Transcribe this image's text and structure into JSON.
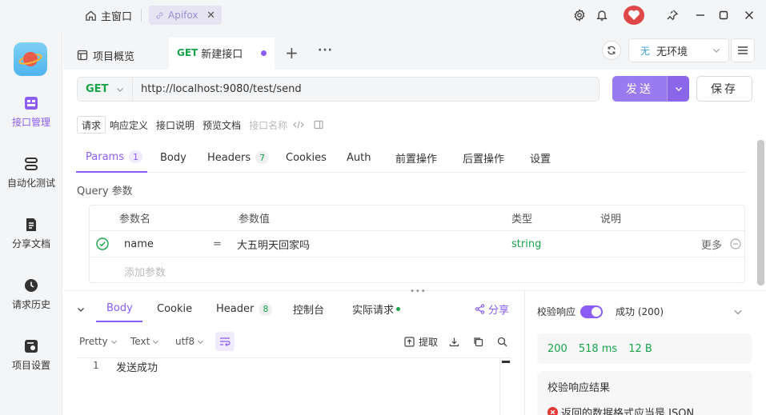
{
  "titlebar": {
    "home_label": "主窗口",
    "app_tab_label": "Apifox"
  },
  "sidebar": {
    "items": [
      {
        "label": "接口管理"
      },
      {
        "label": "自动化测试"
      },
      {
        "label": "分享文档"
      },
      {
        "label": "请求历史"
      },
      {
        "label": "项目设置"
      }
    ]
  },
  "tabs": {
    "overview_label": "项目概览",
    "active_method": "GET",
    "active_label": "新建接口",
    "add": "+",
    "more": "···"
  },
  "env": {
    "badge": "无",
    "label": "无环境"
  },
  "request": {
    "method": "GET",
    "url": "http://localhost:9080/test/send",
    "send_label": "发送",
    "save_label": "保存"
  },
  "subtabs": [
    "请求",
    "响应定义",
    "接口说明",
    "预览文档"
  ],
  "subtab_placeholder": "接口名称",
  "param_tabs": [
    {
      "label": "Params",
      "count": "1"
    },
    {
      "label": "Body"
    },
    {
      "label": "Headers",
      "count": "7"
    },
    {
      "label": "Cookies"
    },
    {
      "label": "Auth"
    },
    {
      "label": "前置操作"
    },
    {
      "label": "后置操作"
    },
    {
      "label": "设置"
    }
  ],
  "query": {
    "title": "Query 参数",
    "headers": {
      "name": "参数名",
      "value": "参数值",
      "type": "类型",
      "desc": "说明"
    },
    "rows": [
      {
        "name": "name",
        "op": "=",
        "value": "大五明天回家吗",
        "type": "string",
        "more": "更多"
      }
    ],
    "add_placeholder": "添加参数"
  },
  "response": {
    "tabs": [
      {
        "label": "Body"
      },
      {
        "label": "Cookie"
      },
      {
        "label": "Header",
        "count": "8"
      },
      {
        "label": "控制台"
      },
      {
        "label": "实际请求"
      }
    ],
    "share_label": "分享",
    "format": "Pretty",
    "type": "Text",
    "encoding": "utf8",
    "extract_label": "提取",
    "line_no": "1",
    "body_text": "发送成功"
  },
  "validation": {
    "label": "校验响应",
    "result_summary": "成功 (200)",
    "status": "200",
    "time": "518 ms",
    "size": "12 B",
    "results_title": "校验响应结果",
    "error_text": "返回的数据格式应当是 JSON"
  },
  "colors": {
    "accent": "#8b5cf6",
    "success": "#16a34a",
    "error": "#e53935"
  }
}
